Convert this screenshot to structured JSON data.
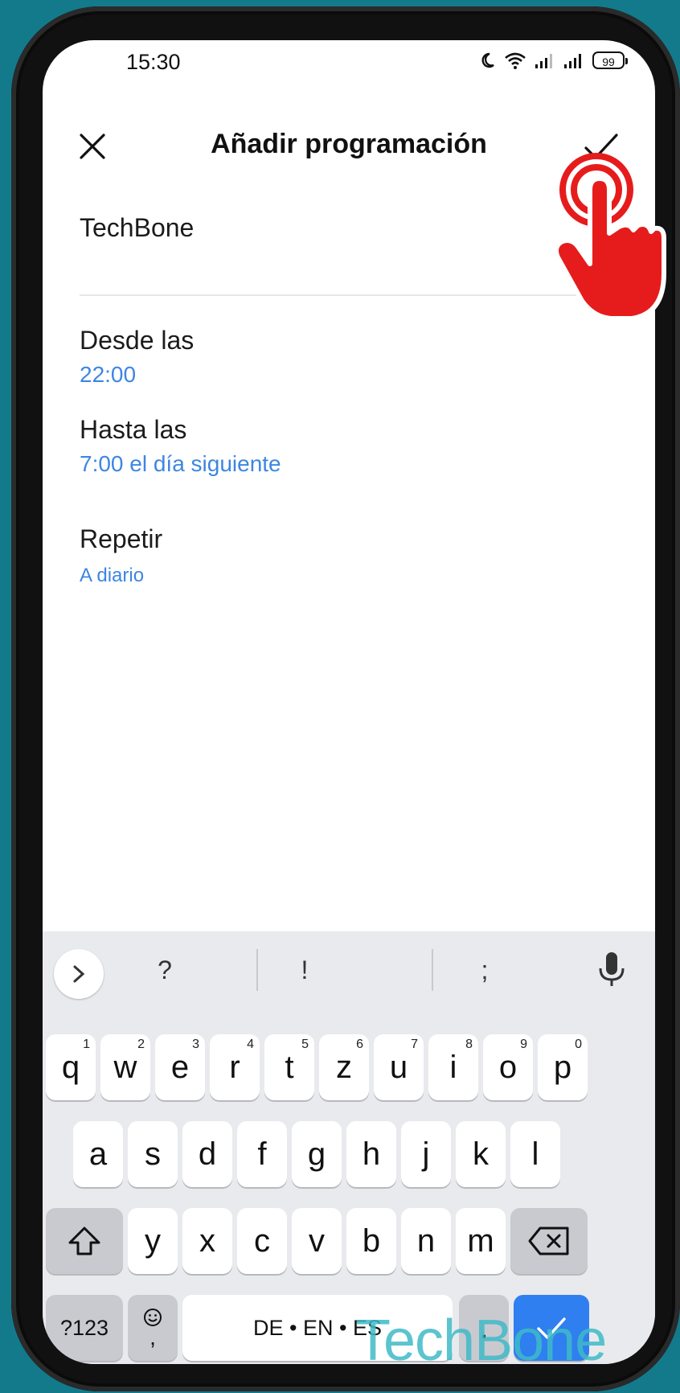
{
  "status_bar": {
    "time": "15:30",
    "battery": "99"
  },
  "header": {
    "title": "Añadir programación"
  },
  "schedule": {
    "name": "TechBone",
    "from_label": "Desde las",
    "from_value": "22:00",
    "to_label": "Hasta las",
    "to_value": "7:00 el día siguiente",
    "repeat_label": "Repetir",
    "repeat_value": "A diario"
  },
  "keyboard": {
    "suggestions": [
      "?",
      "!",
      ";"
    ],
    "row1": [
      {
        "k": "q",
        "n": "1"
      },
      {
        "k": "w",
        "n": "2"
      },
      {
        "k": "e",
        "n": "3"
      },
      {
        "k": "r",
        "n": "4"
      },
      {
        "k": "t",
        "n": "5"
      },
      {
        "k": "z",
        "n": "6"
      },
      {
        "k": "u",
        "n": "7"
      },
      {
        "k": "i",
        "n": "8"
      },
      {
        "k": "o",
        "n": "9"
      },
      {
        "k": "p",
        "n": "0"
      }
    ],
    "row2": [
      "a",
      "s",
      "d",
      "f",
      "g",
      "h",
      "j",
      "k",
      "l"
    ],
    "row3": [
      "y",
      "x",
      "c",
      "v",
      "b",
      "n",
      "m"
    ],
    "symbols_label": "?123",
    "emoji_comma": ",",
    "space_label": "DE • EN • ES",
    "period": "."
  },
  "watermark": "TechBone",
  "colors": {
    "accent": "#3d86e1",
    "background": "#137a8c",
    "enter_key": "#2f7ff0",
    "tap_hand": "#e61c1c"
  }
}
